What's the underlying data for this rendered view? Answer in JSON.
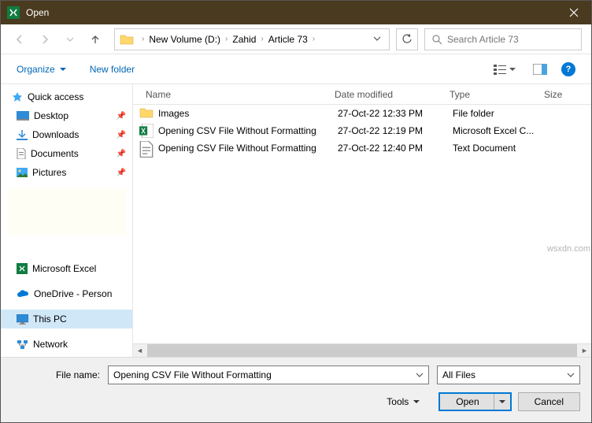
{
  "window": {
    "title": "Open"
  },
  "nav": {
    "crumbs": [
      "New Volume (D:)",
      "Zahid",
      "Article 73"
    ],
    "search_placeholder": "Search Article 73"
  },
  "toolbar": {
    "organize": "Organize",
    "newfolder": "New folder"
  },
  "sidebar": {
    "quick_access": "Quick access",
    "desktop": "Desktop",
    "downloads": "Downloads",
    "documents": "Documents",
    "pictures": "Pictures",
    "excel": "Microsoft Excel",
    "onedrive": "OneDrive - Person",
    "thispc": "This PC",
    "network": "Network"
  },
  "columns": {
    "name": "Name",
    "date": "Date modified",
    "type": "Type",
    "size": "Size"
  },
  "files": [
    {
      "name": "Images",
      "date": "27-Oct-22 12:33 PM",
      "type": "File folder",
      "kind": "folder"
    },
    {
      "name": "Opening CSV File Without Formatting",
      "date": "27-Oct-22 12:19 PM",
      "type": "Microsoft Excel C...",
      "kind": "excel"
    },
    {
      "name": "Opening CSV File Without Formatting",
      "date": "27-Oct-22 12:40 PM",
      "type": "Text Document",
      "kind": "text"
    }
  ],
  "footer": {
    "filename_label": "File name:",
    "filename_value": "Opening CSV File Without Formatting",
    "filter": "All Files",
    "tools": "Tools",
    "open": "Open",
    "cancel": "Cancel"
  },
  "watermark": "wsxdn.com"
}
